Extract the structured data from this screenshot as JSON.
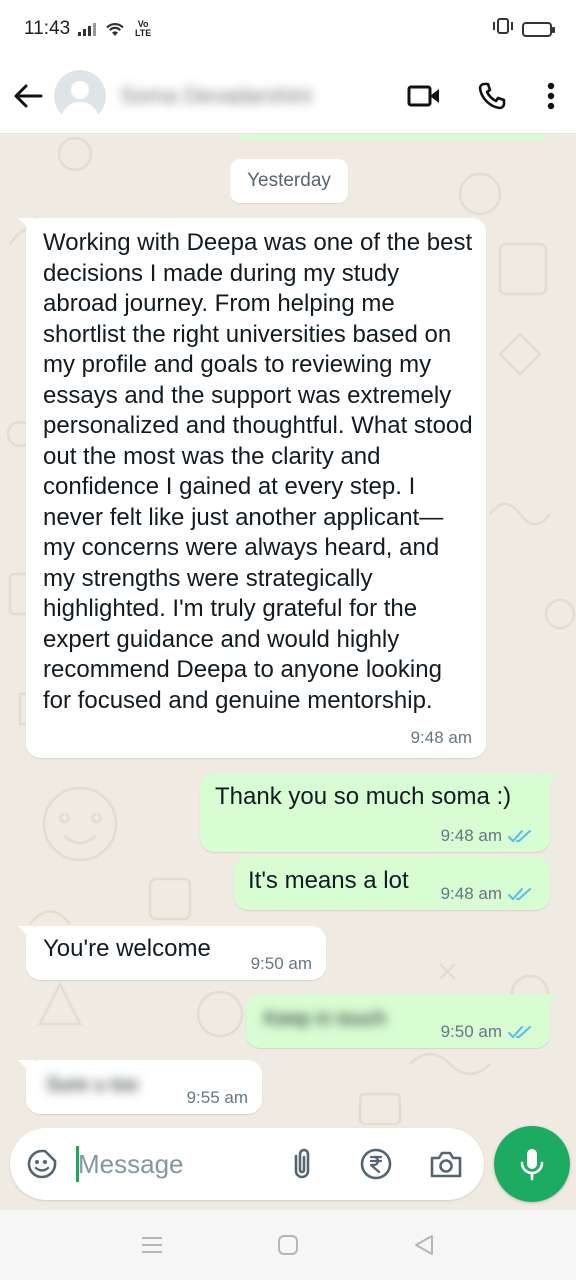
{
  "status_bar": {
    "time": "11:43",
    "network_label": "Vo LTE"
  },
  "header": {
    "contact_name": "Soma Devadarshini"
  },
  "chat": {
    "date_chip": "Yesterday",
    "messages": [
      {
        "direction": "incoming",
        "text": "Working with Deepa was one of the best decisions I made during my study abroad journey. From helping me shortlist the right universities based on my profile and goals to reviewing my essays and the support was extremely personalized and thoughtful. What stood out the most was the clarity and confidence I gained at every step. I never felt like just another applicant—my concerns were always heard, and my strengths were strategically highlighted. I'm truly grateful for the expert guidance and would highly recommend Deepa to anyone looking for focused and genuine mentorship.",
        "time": "9:48 am"
      },
      {
        "direction": "outgoing",
        "text": "Thank you so much soma :)",
        "time": "9:48 am",
        "status": "read"
      },
      {
        "direction": "outgoing",
        "text": "It's means a lot",
        "time": "9:48 am",
        "status": "read"
      },
      {
        "direction": "incoming",
        "text": "You're welcome",
        "time": "9:50 am"
      },
      {
        "direction": "outgoing",
        "text": "Keep in touch",
        "time": "9:50 am",
        "status": "read",
        "blurred": true
      },
      {
        "direction": "incoming",
        "text": "Sure u too",
        "time": "9:55 am",
        "blurred": true
      }
    ]
  },
  "composer": {
    "placeholder": "Message"
  },
  "colors": {
    "header_bg": "#ffffff",
    "chat_bg": "#efeae2",
    "incoming_bubble": "#ffffff",
    "outgoing_bubble": "#d9fdd3",
    "accent_green": "#1daa61",
    "read_ticks": "#53bdeb",
    "meta_text": "#667781"
  },
  "icons": {
    "header": [
      "back-arrow-icon",
      "avatar",
      "video-call-icon",
      "voice-call-icon",
      "more-vert-icon"
    ],
    "composer": [
      "sticker-icon",
      "attach-icon",
      "rupee-payment-icon",
      "camera-icon",
      "mic-icon"
    ],
    "navigation": [
      "recents-icon",
      "home-icon",
      "back-nav-icon"
    ]
  }
}
